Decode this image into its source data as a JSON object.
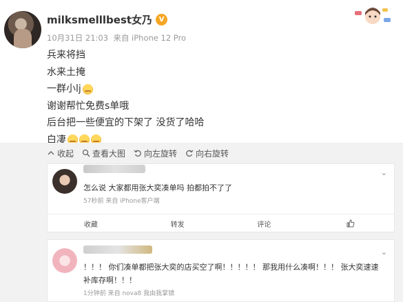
{
  "header": {
    "username": "milksmelllbest女乃",
    "time": "10月31日 21:03",
    "source": "来自 iPhone 12 Pro"
  },
  "post": {
    "lines": [
      "兵来将挡",
      "水来土掩",
      "一群小lj",
      "谢谢帮忙免费s单哦",
      "后台把一些便宜的下架了 没货了哈哈",
      "白凄"
    ]
  },
  "toolbar": {
    "collapse": "收起",
    "view_large": "查看大图",
    "rotate_left": "向左旋转",
    "rotate_right": "向右旋转"
  },
  "comments": [
    {
      "text": "怎么说 大家都用张大奕凑单吗 拍都拍不了了",
      "meta": "57秒前 来自 iPhone客户端",
      "actions": {
        "collect": "收藏",
        "repost": "转发",
        "comment": "评论"
      }
    },
    {
      "text": "！！！ 你们凑单都把张大奕的店买空了啊！！！！！ 那我用什么凑啊！！！ 张大奕速速补库存啊！！！",
      "meta": "1分钟前 来自 nova8 我由我掌镜"
    }
  ]
}
